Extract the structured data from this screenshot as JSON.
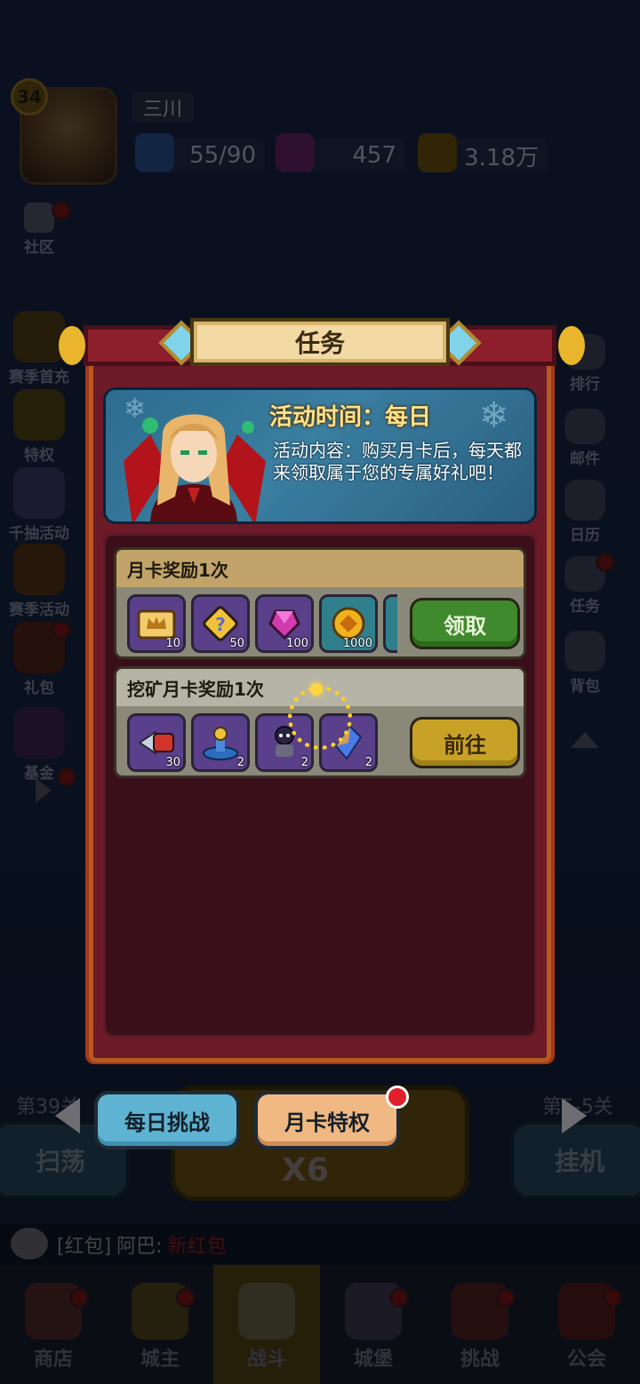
{
  "player": {
    "level": "34",
    "name": "三川"
  },
  "resources": {
    "energy": "55/90",
    "gems": "457",
    "gold": "3.18万"
  },
  "left_menu": [
    "社区",
    "赛季首充",
    "特权",
    "千抽活动",
    "赛季活动",
    "礼包",
    "基金"
  ],
  "right_menu": [
    "排行",
    "邮件",
    "日历",
    "任务",
    "背包"
  ],
  "stage": {
    "left": "第39关",
    "right": "第5-5关"
  },
  "main_buttons": {
    "sweep": "扫荡",
    "idle": "挂机",
    "multiplier": "X6"
  },
  "chat": {
    "tag": "[红包]",
    "user": "阿巴:",
    "message": "新红包"
  },
  "bottom_nav": [
    "商店",
    "城主",
    "战斗",
    "城堡",
    "挑战",
    "公会"
  ],
  "modal": {
    "title": "任务",
    "banner": {
      "time": "活动时间：每日",
      "content": "活动内容：购买月卡后，每天都来领取属于您的专属好礼吧！"
    },
    "tasks": [
      {
        "title": "月卡奖励1次",
        "button": "领取",
        "items": [
          {
            "icon": "gold-crown-card-icon",
            "count": "10"
          },
          {
            "icon": "mystery-puzzle-icon",
            "count": "50"
          },
          {
            "icon": "purple-gem-icon",
            "count": "100"
          },
          {
            "icon": "gold-coin-icon",
            "count": "1000"
          }
        ]
      },
      {
        "title": "挖矿月卡奖励1次",
        "button": "前往",
        "items": [
          {
            "icon": "drill-icon",
            "count": "30"
          },
          {
            "icon": "summon-altar-icon",
            "count": "2"
          },
          {
            "icon": "miner-icon",
            "count": "2"
          },
          {
            "icon": "crystal-shard-icon",
            "count": "2"
          }
        ]
      }
    ]
  },
  "tabs": {
    "daily": "每日挑战",
    "monthly": "月卡特权"
  },
  "colors": {
    "modal_bg": "#6d1a28",
    "header_plate": "#f3d9a4",
    "claim_green": "#3f8a2c",
    "goto_yellow": "#c7a226",
    "alert_red": "#e2202c"
  }
}
